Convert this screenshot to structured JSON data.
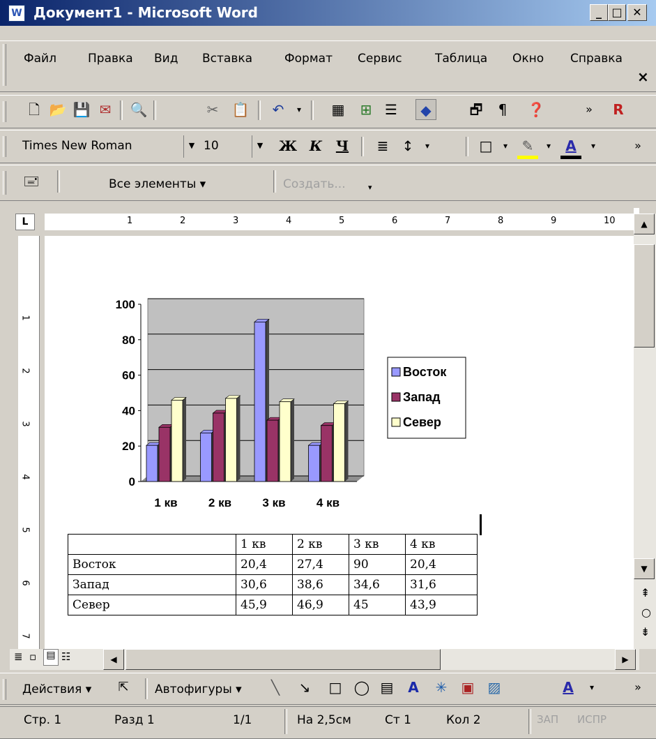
{
  "window": {
    "title": "Документ1 - Microsoft Word",
    "app_icon": "word-doc-icon"
  },
  "menu": {
    "items": [
      "Файл",
      "Правка",
      "Вид",
      "Вставка",
      "Формат",
      "Сервис",
      "Таблица",
      "Окно",
      "Справка"
    ],
    "close_glyph": "×"
  },
  "format_bar": {
    "font": "Times New Roman",
    "size": "10",
    "bold": "Ж",
    "italic": "К",
    "underline": "Ч"
  },
  "outlook_bar": {
    "all_items": "Все элементы ▾",
    "create": "Создать..."
  },
  "drawing_bar": {
    "actions": "Действия ▾",
    "autoshapes": "Автофигуры ▾"
  },
  "ruler": {
    "numbers": [
      "1",
      "2",
      "3",
      "4",
      "5",
      "6",
      "7",
      "8",
      "9",
      "10"
    ],
    "left_numbers": [
      "1",
      "2",
      "3",
      "4",
      "5",
      "6",
      "7"
    ]
  },
  "chart_data": {
    "type": "bar",
    "categories": [
      "1 кв",
      "2 кв",
      "3 кв",
      "4 кв"
    ],
    "series": [
      {
        "name": "Восток",
        "values": [
          20.4,
          27.4,
          90,
          20.4
        ],
        "color": "#9999ff"
      },
      {
        "name": "Запад",
        "values": [
          30.6,
          38.6,
          34.6,
          31.6
        ],
        "color": "#993366"
      },
      {
        "name": "Север",
        "values": [
          45.9,
          46.9,
          45,
          43.9
        ],
        "color": "#ffffcc"
      }
    ],
    "ylim": [
      0,
      100
    ],
    "yticks": [
      "0",
      "20",
      "40",
      "60",
      "80",
      "100"
    ],
    "grid": true,
    "legend": "right",
    "plot_bg": "#c0c0c0"
  },
  "table": {
    "header": [
      "",
      "1 кв",
      "2 кв",
      "3 кв",
      "4 кв"
    ],
    "rows": [
      [
        "Восток",
        "20,4",
        "27,4",
        "90",
        "20,4"
      ],
      [
        "Запад",
        "30,6",
        "38,6",
        "34,6",
        "31,6"
      ],
      [
        "Север",
        "45,9",
        "46,9",
        "45",
        "43,9"
      ]
    ]
  },
  "status": {
    "page": "Стр. 1",
    "section": "Разд 1",
    "pages": "1/1",
    "at": "На 2,5см",
    "line": "Ст 1",
    "col": "Кол 2",
    "rec": "ЗАП",
    "trk": "ИСПР"
  }
}
